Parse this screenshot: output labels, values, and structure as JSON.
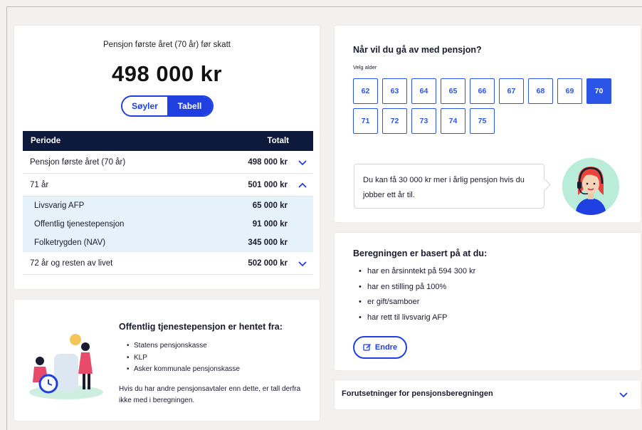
{
  "summary": {
    "label": "Pensjon første året (70 år) før skatt",
    "amount": "498 000 kr",
    "toggle": {
      "bars": "Søyler",
      "table": "Tabell",
      "selected": "Tabell"
    },
    "table": {
      "headers": {
        "period": "Periode",
        "total": "Totalt"
      },
      "rows": [
        {
          "label": "Pensjon første året (70 år)",
          "value": "498 000 kr",
          "expanded": false
        },
        {
          "label": "71 år",
          "value": "501 000 kr",
          "expanded": true
        },
        {
          "label": "72 år og resten av livet",
          "value": "502 000 kr",
          "expanded": false
        }
      ],
      "subrows": [
        {
          "label": "Livsvarig AFP",
          "value": "65 000 kr"
        },
        {
          "label": "Offentlig tjenestepensjon",
          "value": "91 000 kr"
        },
        {
          "label": "Folketrygden (NAV)",
          "value": "345 000 kr"
        }
      ]
    }
  },
  "source": {
    "title": "Offentlig tjenestepensjon er hentet fra:",
    "items": [
      "Statens pensjonskasse",
      "KLP",
      "Asker kommunale pensjonskasse"
    ],
    "note": "Hvis du har andre pensjonsavtaler enn dette, er tall derfra ikke med i beregningen."
  },
  "age": {
    "title": "Når vil du gå av med pensjon?",
    "subtitle": "Velg alder",
    "options": [
      "62",
      "63",
      "64",
      "65",
      "66",
      "67",
      "68",
      "69",
      "70",
      "71",
      "72",
      "73",
      "74",
      "75"
    ],
    "selected": "70",
    "bubble": "Du kan få 30 000 kr mer i årlig pensjon hvis du jobber ett år til."
  },
  "basis": {
    "title": "Beregningen er basert på at du:",
    "items": [
      "har en årsinntekt på 594 300 kr",
      "har en stilling på 100%",
      "er gift/samboer",
      "har rett til livsvarig AFP"
    ],
    "edit_label": "Endre"
  },
  "assumptions": {
    "label": "Forutsetninger for pensjonsberegningen"
  },
  "colors": {
    "accent": "#1f3fe0",
    "header": "#0d1a3b",
    "highlight": "#e6f2fa",
    "avatar_bg": "#b9ecd9"
  }
}
